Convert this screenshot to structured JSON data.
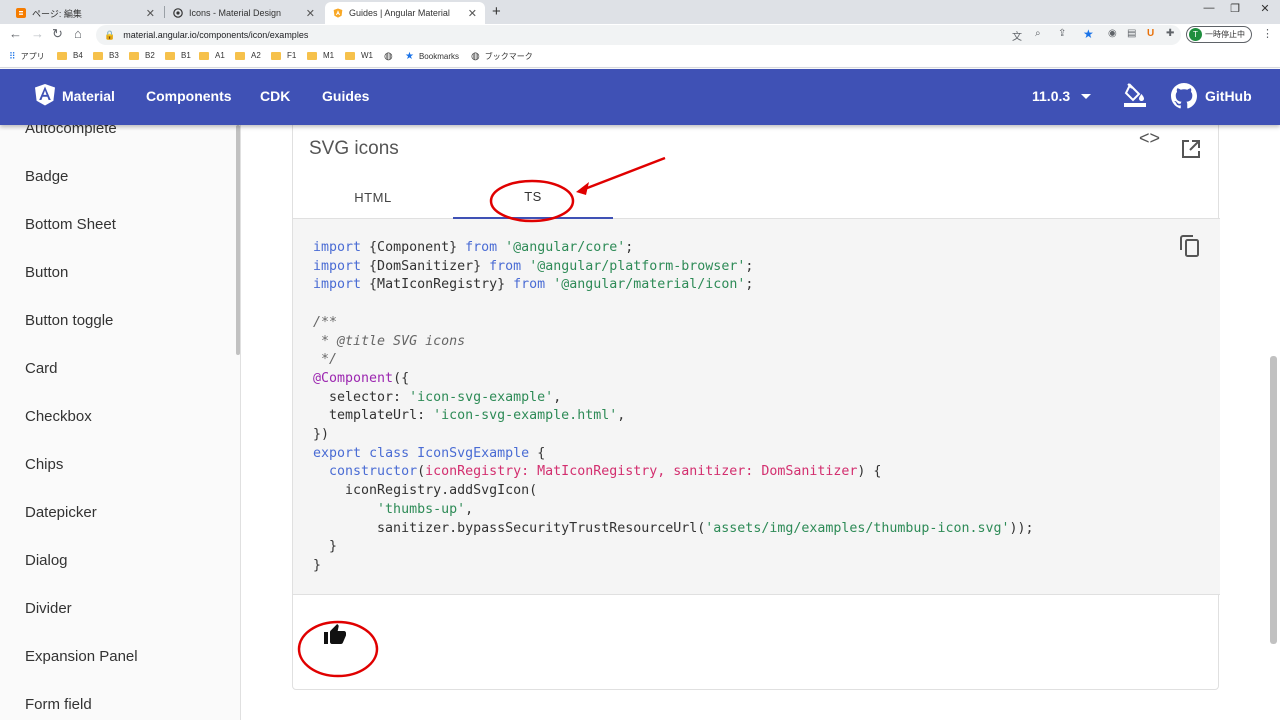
{
  "browser": {
    "tabs": [
      {
        "title": "ページ: 編集",
        "favicon": "blogger-icon",
        "color": "#f57c00"
      },
      {
        "title": "Icons - Material Design",
        "favicon": "material-design-icon",
        "color": "#333333"
      },
      {
        "title": "Guides | Angular Material",
        "favicon": "angular-material-icon",
        "color": "#f9a825"
      }
    ],
    "url": "material.angular.io/components/icon/examples",
    "profile_initial": "T",
    "profile_label": "一時停止中",
    "bookmarks": [
      "アプリ",
      "B4",
      "B3",
      "B2",
      "B1",
      "A1",
      "A2",
      "F1",
      "M1",
      "W1",
      "Bookmarks",
      "ブックマーク"
    ]
  },
  "header": {
    "brand": "Material",
    "nav": [
      "Components",
      "CDK",
      "Guides"
    ],
    "version": "11.0.3",
    "github": "GitHub",
    "bg_color": "#3f51b5"
  },
  "sidebar": {
    "items": [
      "Autocomplete",
      "Badge",
      "Bottom Sheet",
      "Button",
      "Button toggle",
      "Card",
      "Checkbox",
      "Chips",
      "Datepicker",
      "Dialog",
      "Divider",
      "Expansion Panel",
      "Form field"
    ]
  },
  "example": {
    "title": "SVG icons",
    "tabs": [
      "HTML",
      "TS"
    ],
    "active_tab": "TS",
    "code": {
      "l1": {
        "kw": "import",
        "a": " {Component} ",
        "from": "from",
        "str": "'@angular/core'",
        "end": ";"
      },
      "l2": {
        "kw": "import",
        "a": " {DomSanitizer} ",
        "from": "from",
        "str": "'@angular/platform-browser'",
        "end": ";"
      },
      "l3": {
        "kw": "import",
        "a": " {MatIconRegistry} ",
        "from": "from",
        "str": "'@angular/material/icon'",
        "end": ";"
      },
      "c1": "/**",
      "c2": " * @title SVG icons",
      "c3": " */",
      "dec": "@Component",
      "dec_open": "({",
      "sel_key": "  selector: ",
      "sel_val": "'icon-svg-example'",
      "tpl_key": "  templateUrl: ",
      "tpl_val": "'icon-svg-example.html'",
      "comma": ",",
      "dec_close": "})",
      "export": "export",
      "class": "class",
      "classname": "IconSvgExample",
      "brace_open": " {",
      "ctor": "constructor",
      "ctor_params": "iconRegistry: MatIconRegistry, sanitizer: DomSanitizer",
      "ctor_end": ") {",
      "reg_line": "iconRegistry.addSvgIcon(",
      "icon_name": "'thumbs-up'",
      "san_line": "sanitizer.bypassSecurityTrustResourceUrl(",
      "san_url": "'assets/img/examples/thumbup-icon.svg'",
      "san_end": "));",
      "close1": "  }",
      "close2": "}"
    },
    "result_icon": "thumb-up-icon"
  },
  "annotation_color": "#e00000"
}
